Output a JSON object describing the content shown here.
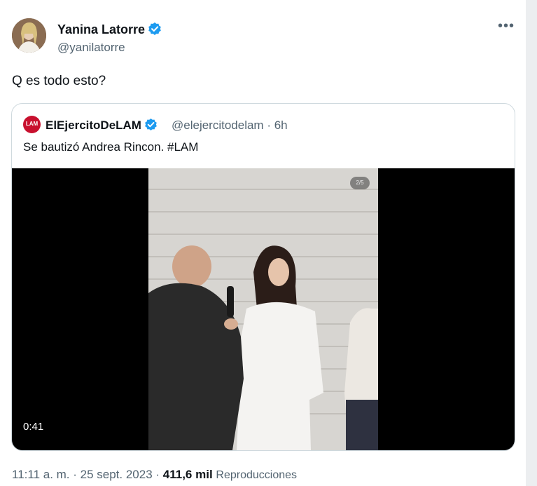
{
  "author": {
    "name": "Yanina Latorre",
    "handle": "@yanilatorre"
  },
  "tweet": {
    "text": "Q es todo esto?"
  },
  "quoted": {
    "avatar_text": "LAM",
    "name": "ElEjercitoDeLAM",
    "meta": "@elejercitodelam · 6h",
    "text": "Se bautizó Andrea Rincon. #LAM",
    "video": {
      "duration": "0:41",
      "page_indicator": "2/5"
    }
  },
  "footer": {
    "time_date": "11:11 a. m. · 25 sept. 2023 · ",
    "views_count": "411,6 mil",
    "views_label": "Reproducciones"
  },
  "colors": {
    "verified": "#1d9bf0",
    "secondary_text": "#536471",
    "border": "#cfd9de"
  }
}
